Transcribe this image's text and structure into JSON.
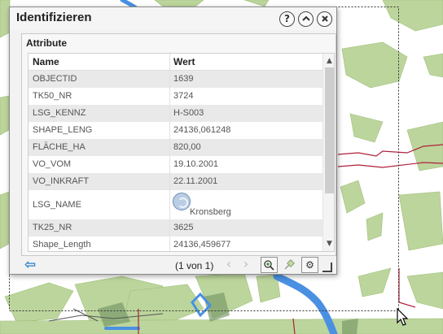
{
  "dialog": {
    "title": "Identifizieren",
    "help_icon": "question-icon",
    "collapse_icon": "chevron-up-icon",
    "close_icon": "close-icon",
    "section_title": "Attribute",
    "columns": {
      "name": "Name",
      "value": "Wert"
    },
    "rows": [
      {
        "name": "OBJECTID",
        "value": "1639"
      },
      {
        "name": "TK50_NR",
        "value": "3724"
      },
      {
        "name": "LSG_KENNZ",
        "value": "H-S003"
      },
      {
        "name": "SHAPE_LENG",
        "value": "24136,061248"
      },
      {
        "name": "FLÄCHE_HA",
        "value": "820,00"
      },
      {
        "name": "VO_VOM",
        "value": "19.10.2001"
      },
      {
        "name": "VO_INKRAFT",
        "value": "22.11.2001"
      },
      {
        "name": "LSG_NAME",
        "value": "Kronsberg",
        "icon": "globe-icon"
      },
      {
        "name": "TK25_NR",
        "value": "3625"
      },
      {
        "name": "Shape_Length",
        "value": "24136,459677"
      }
    ],
    "pager": "(1 von 1)",
    "footer_icons": {
      "back": "arrow-left-icon",
      "prev": "chevron-left-icon",
      "next": "chevron-right-icon",
      "zoom": "zoom-to-icon",
      "pin": "pin-icon",
      "settings": "gear-icon"
    }
  },
  "colors": {
    "map_green": "#b8d49a",
    "water_blue": "#4a90e2",
    "boundary_red": "#b0203a",
    "accent_blue": "#2d7fd0"
  }
}
